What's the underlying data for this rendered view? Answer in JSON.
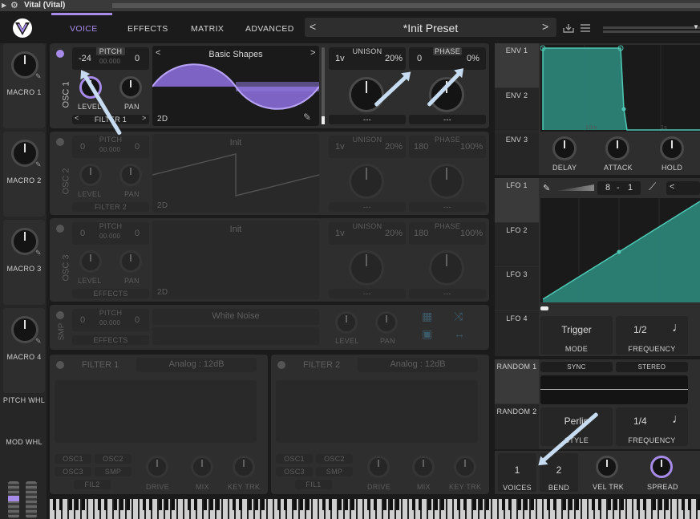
{
  "window": {
    "title": "Vital (Vital)"
  },
  "tabs": [
    "VOICE",
    "EFFECTS",
    "MATRIX",
    "ADVANCED"
  ],
  "preset": {
    "name": "*Init Preset"
  },
  "macros": [
    "MACRO 1",
    "MACRO 2",
    "MACRO 3",
    "MACRO 4"
  ],
  "wheels": {
    "pitch": "PITCH WHL",
    "mod": "MOD WHL"
  },
  "osc1": {
    "label": "OSC 1",
    "pitch_label": "PITCH",
    "pitch_coarse": "-24",
    "pitch_fine": "0",
    "pitch_dots": "00.000",
    "wavetable": "Basic Shapes",
    "dim": "2D",
    "level": "LEVEL",
    "pan": "PAN",
    "filter": "FILTER 1",
    "unison_label": "UNISON",
    "voices": "1v",
    "detune": "20%",
    "phase_label": "PHASE",
    "phase": "0",
    "phase_rand": "0%",
    "dash1": "---",
    "dash2": "---"
  },
  "osc2": {
    "label": "OSC 2",
    "pitch_label": "PITCH",
    "pitch_coarse": "0",
    "pitch_fine": "0",
    "pitch_dots": "00.000",
    "wavetable": "Init",
    "dim": "2D",
    "level": "LEVEL",
    "pan": "PAN",
    "filter": "FILTER 2",
    "unison_label": "UNISON",
    "voices": "1v",
    "detune": "20%",
    "phase_label": "PHASE",
    "phase": "180",
    "phase_rand": "100%",
    "dash1": "---",
    "dash2": "---"
  },
  "osc3": {
    "label": "OSC 3",
    "pitch_label": "PITCH",
    "pitch_coarse": "0",
    "pitch_fine": "0",
    "pitch_dots": "00.000",
    "wavetable": "Init",
    "dim": "2D",
    "level": "LEVEL",
    "pan": "PAN",
    "filter": "EFFECTS",
    "unison_label": "UNISON",
    "voices": "1v",
    "detune": "20%",
    "phase_label": "PHASE",
    "phase": "180",
    "phase_rand": "100%",
    "dash1": "---",
    "dash2": "---"
  },
  "smp": {
    "label": "SMP",
    "pitch_label": "PITCH",
    "pitch_coarse": "0",
    "pitch_fine": "0",
    "pitch_dots": "00.000",
    "sample": "White Noise",
    "level": "LEVEL",
    "pan": "PAN",
    "filter": "EFFECTS"
  },
  "filter1": {
    "title": "FILTER 1",
    "type": "Analog : 12dB",
    "osc1": "OSC1",
    "osc2": "OSC2",
    "osc3": "OSC3",
    "smp": "SMP",
    "fil": "FIL2",
    "drive": "DRIVE",
    "mix": "MIX",
    "keytrk": "KEY TRK"
  },
  "filter2": {
    "title": "FILTER 2",
    "type": "Analog : 12dB",
    "osc1": "OSC1",
    "osc2": "OSC2",
    "osc3": "OSC3",
    "smp": "SMP",
    "fil": "FIL1",
    "drive": "DRIVE",
    "mix": "MIX",
    "keytrk": "KEY TRK"
  },
  "env": {
    "tabs": [
      "ENV 1",
      "ENV 2",
      "ENV 3"
    ],
    "knobs": [
      "DELAY",
      "ATTACK",
      "HOLD"
    ],
    "marks": [
      "10m",
      "1s"
    ]
  },
  "lfo": {
    "tabs": [
      "LFO 1",
      "LFO 2",
      "LFO 3",
      "LFO 4"
    ],
    "rate": "8",
    "rate_sep": "-",
    "rate2": "1",
    "mode": "Trigger",
    "mode_label": "MODE",
    "freq": "1/2",
    "freq_label": "FREQUENCY"
  },
  "random": {
    "tabs": [
      "RANDOM 1",
      "RANDOM 2"
    ],
    "sync": "SYNC",
    "stereo": "STEREO",
    "style": "Perlin",
    "style_label": "STYLE",
    "freq": "1/4",
    "freq_label": "FREQUENCY"
  },
  "voice": {
    "voices": "1",
    "voices_label": "VOICES",
    "bend": "2",
    "bend_label": "BEND",
    "veltrk": "VEL TRK",
    "spread": "SPREAD"
  },
  "colors": {
    "accent": "#a78be8",
    "mod": "#4fc9b5",
    "arrow": "#c7dcf0"
  }
}
